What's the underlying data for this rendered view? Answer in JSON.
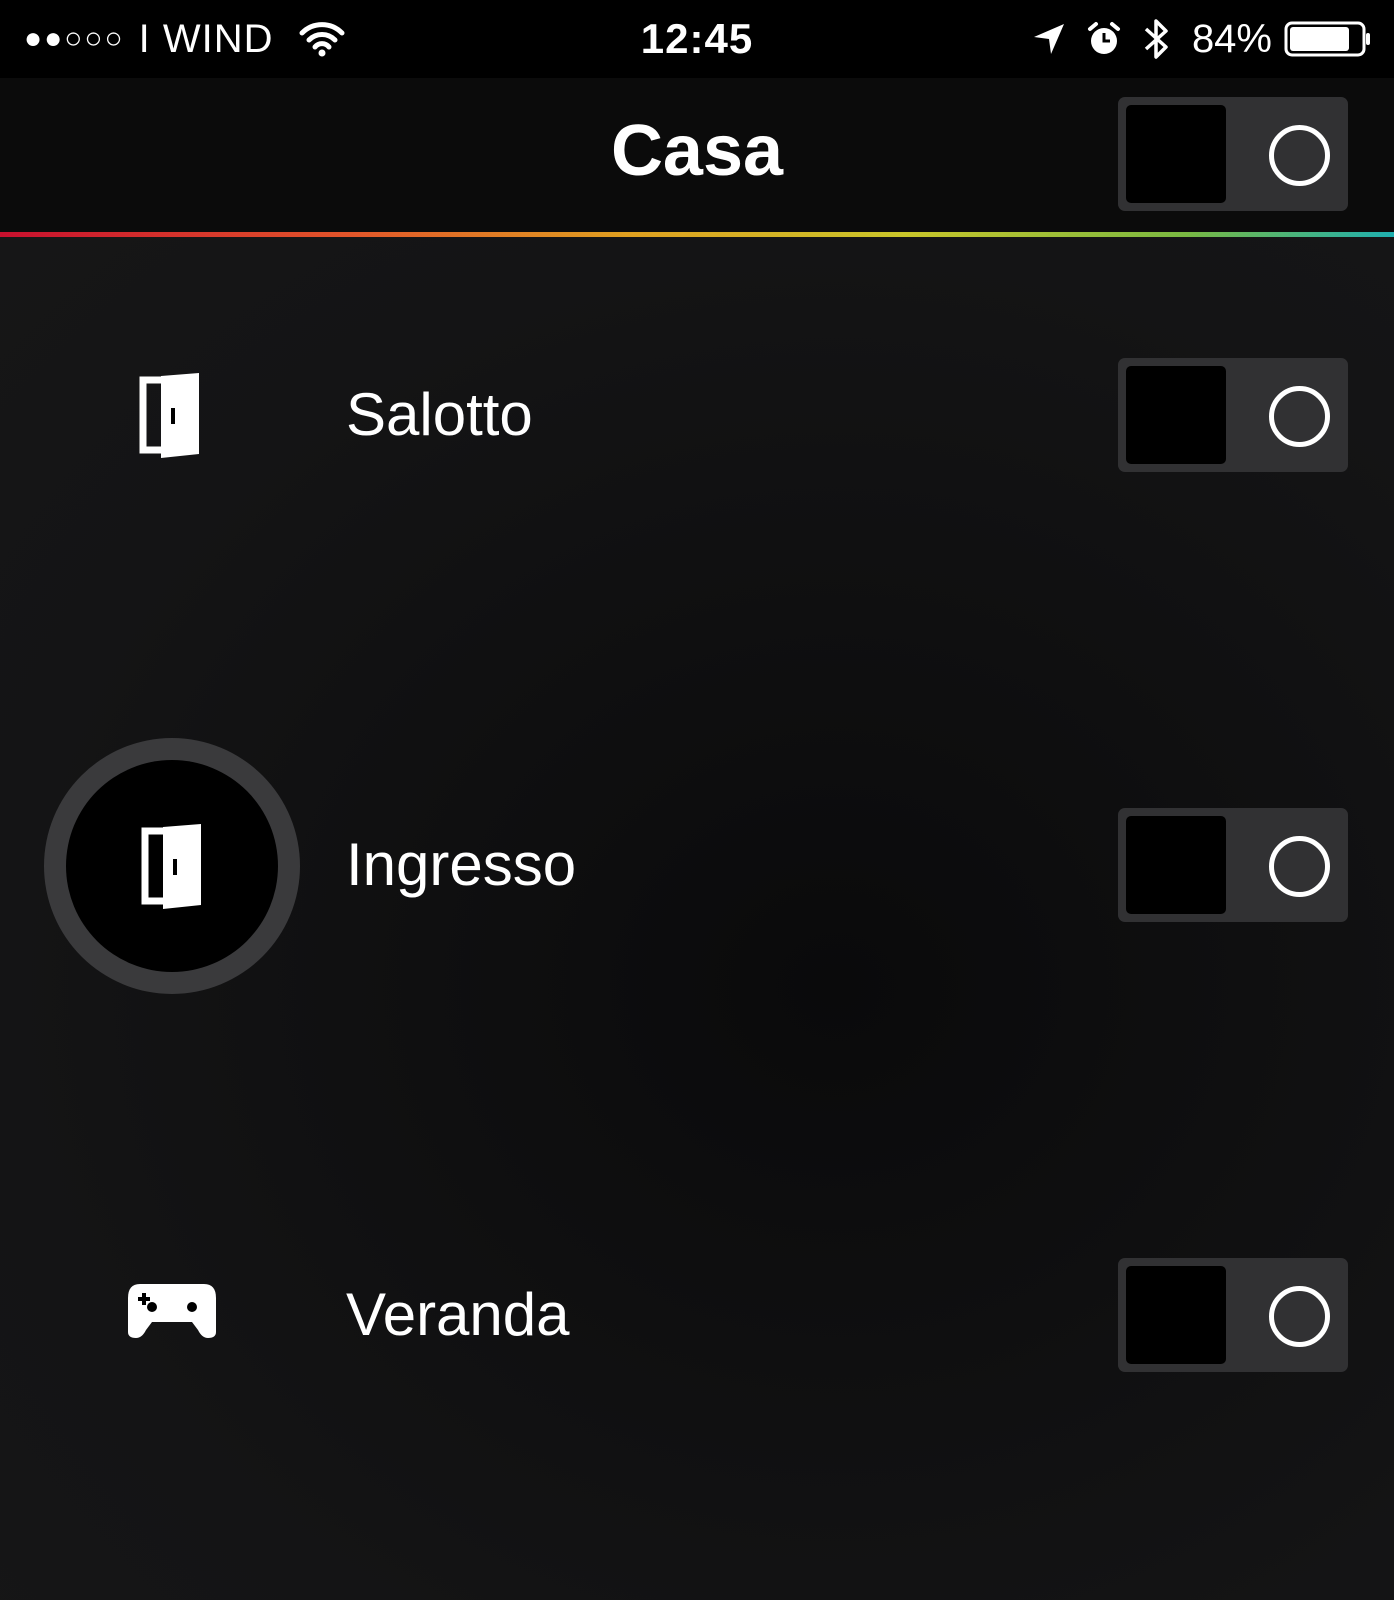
{
  "status_bar": {
    "signal": "●●○○○",
    "carrier": "I WIND",
    "time": "12:45",
    "battery_percent": "84%",
    "battery_level": 0.84,
    "icons": [
      "wifi-icon",
      "location-arrow-icon",
      "alarm-icon",
      "bluetooth-icon",
      "battery-icon"
    ]
  },
  "header": {
    "title": "Casa",
    "toggle_on": false
  },
  "rooms": [
    {
      "label": "Salotto",
      "icon": "door-icon",
      "toggle_on": false
    },
    {
      "label": "Ingresso",
      "icon": "door-icon",
      "toggle_on": false,
      "selected": true
    },
    {
      "label": "Veranda",
      "icon": "gamepad-icon",
      "toggle_on": false
    }
  ],
  "colors": {
    "background": "#0d0d0e",
    "toggle_track": "#313133",
    "toggle_knob": "#000000",
    "accent_gradient": [
      "#c8102e",
      "#e2552a",
      "#e0a020",
      "#c9c62a",
      "#7ab942",
      "#1fb0b0"
    ]
  }
}
